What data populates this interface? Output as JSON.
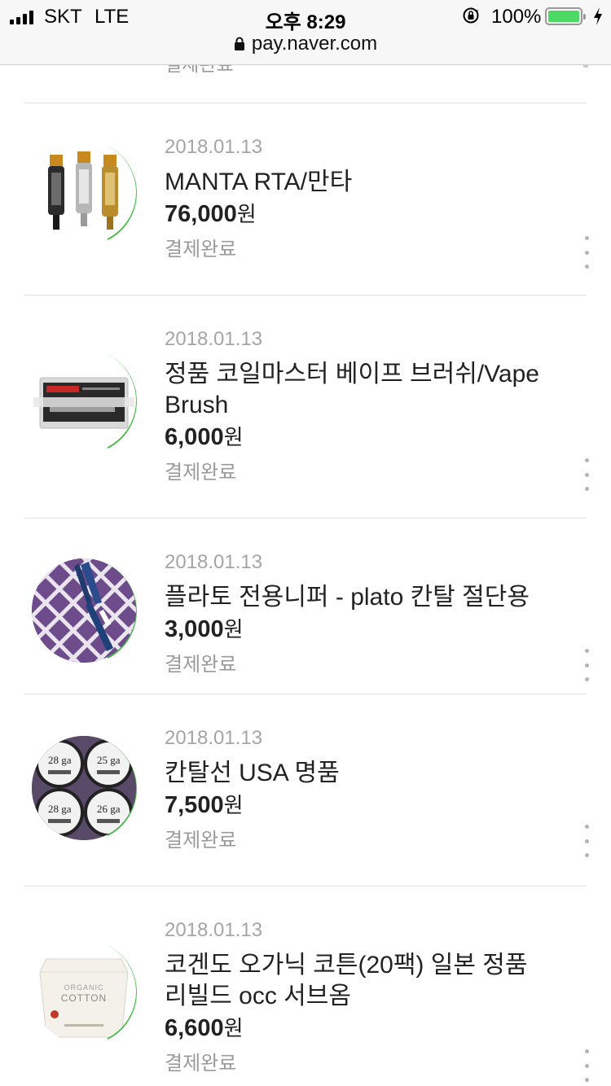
{
  "status_bar": {
    "carrier": "SKT",
    "network": "LTE",
    "time": "오후 8:29",
    "battery": "100%",
    "battery_color": "#4cd964"
  },
  "browser": {
    "url": "pay.naver.com"
  },
  "cut_off_item": {
    "status": "결제완료"
  },
  "accent_color": "#3fb93f",
  "orders": [
    {
      "date": "2018.01.13",
      "name": "MANTA RTA/만타",
      "price": "76,000",
      "currency": "원",
      "status": "결제완료",
      "image": "vape-tanks-image"
    },
    {
      "date": "2018.01.13",
      "name": "정품 코일마스터 베이프 브러쉬/Vape Brush",
      "price": "6,000",
      "currency": "원",
      "status": "결제완료",
      "image": "vape-brush-image"
    },
    {
      "date": "2018.01.13",
      "name": "플라토 전용니퍼 - plato 칸탈 절단용",
      "price": "3,000",
      "currency": "원",
      "status": "결제완료",
      "image": "nipper-image"
    },
    {
      "date": "2018.01.13",
      "name": "칸탈선 USA 명품",
      "price": "7,500",
      "currency": "원",
      "status": "결제완료",
      "image": "kanthal-wire-image",
      "image_labels": [
        "28 ga",
        "25 ga",
        "28 ga",
        "26 ga"
      ]
    },
    {
      "date": "2018.01.13",
      "name": "코겐도 오가닉 코튼(20팩) 일본 정품 리빌드 occ 서브옴",
      "price": "6,600",
      "currency": "원",
      "status": "결제완료",
      "image": "organic-cotton-image",
      "image_labels": [
        "ORGANIC",
        "COTTON"
      ]
    }
  ]
}
